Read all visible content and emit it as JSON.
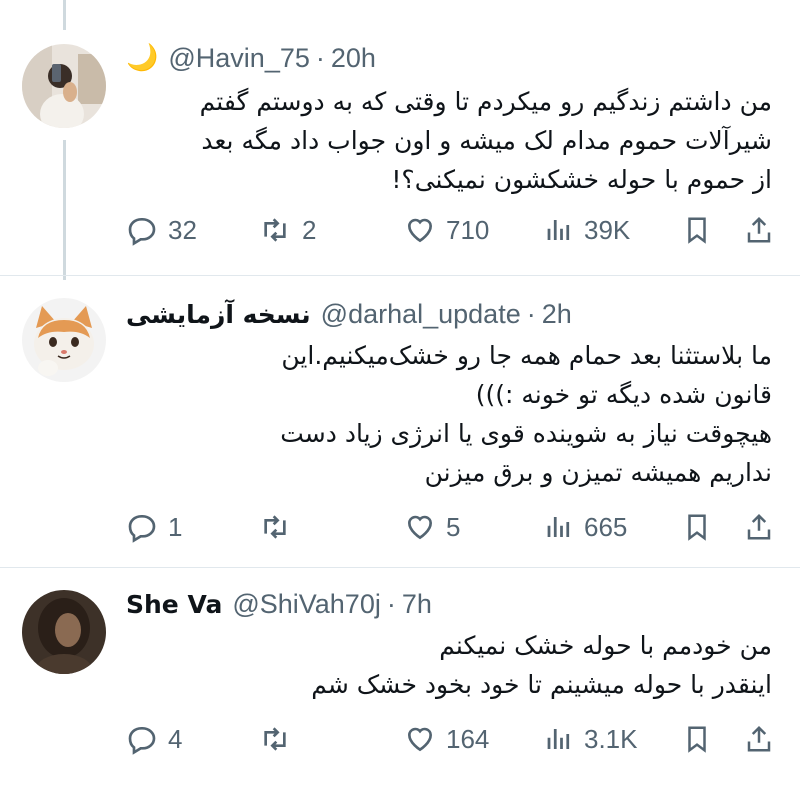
{
  "tweets": [
    {
      "display_name": "",
      "emoji": "🌙",
      "handle": "@Havin_75",
      "separator": "·",
      "time": "20h",
      "lines": [
        "من داشتم زندگیم رو میکردم تا وقتی که به دوستم گفتم",
        "شیرآلات حموم مدام لک میشه و اون جواب داد مگه بعد",
        "از حموم با حوله خشکشون نمیکنی؟!"
      ],
      "replies": "32",
      "retweets": "2",
      "likes": "710",
      "views": "39K"
    },
    {
      "display_name": "نسخه آزمایشی",
      "handle": "@darhal_update",
      "separator": "·",
      "time": "2h",
      "lines": [
        "ما بلاستثنا بعد حمام همه جا رو خشک‌میکنیم.این",
        "قانون شده دیگه تو خونه :)))",
        "هیچوقت نیاز به شوینده قوی یا انرژی زیاد دست",
        "نداریم همیشه تمیزن و برق میزنن"
      ],
      "replies": "1",
      "retweets": "",
      "likes": "5",
      "views": "665"
    },
    {
      "display_name": "She Va",
      "handle": "@ShiVah70j",
      "separator": "·",
      "time": "7h",
      "lines": [
        "من خودمم با حوله خشک نمیکنم",
        "اینقدر با حوله میشینم تا خود بخود خشک شم"
      ],
      "replies": "4",
      "retweets": "",
      "likes": "164",
      "views": "3.1K"
    }
  ],
  "icons": {
    "reply": "reply-icon",
    "retweet": "retweet-icon",
    "like": "heart-icon",
    "views": "views-icon",
    "bookmark": "bookmark-icon",
    "share": "share-icon"
  },
  "colors": {
    "text": "#0f1419",
    "secondary": "#536471",
    "divider": "#e1e8ed",
    "moon": "#f5c518"
  }
}
